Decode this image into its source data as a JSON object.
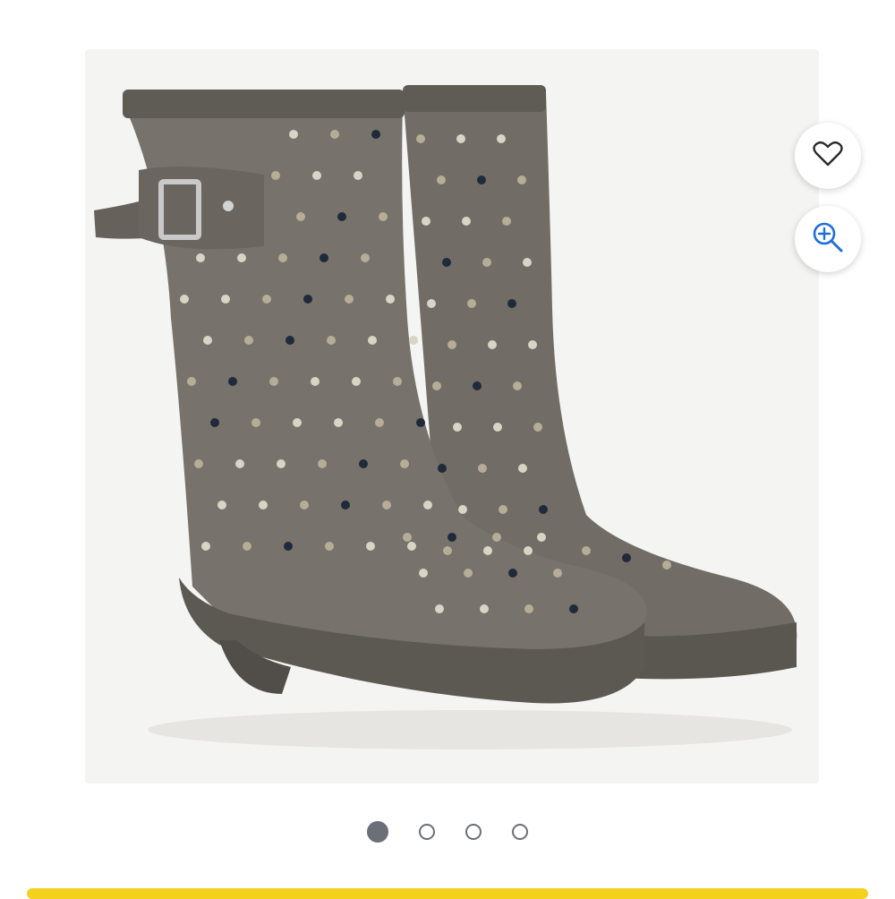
{
  "gallery": {
    "image": {
      "subject": "polka-dot-rain-boots",
      "colors": {
        "boot": "#6e6a63",
        "boot_dark": "#5a5650",
        "sole": "#5e5a54",
        "dot_light": "#d8d4c6",
        "dot_tan": "#b6ad97",
        "dot_navy": "#1f2a3a"
      }
    },
    "favorite_icon": "heart-icon",
    "zoom_icon": "zoom-in-icon",
    "accent": "#1f6fd6",
    "pagination": {
      "count": 4,
      "active_index": 0
    }
  },
  "promo": {
    "color": "#f3d11c"
  }
}
